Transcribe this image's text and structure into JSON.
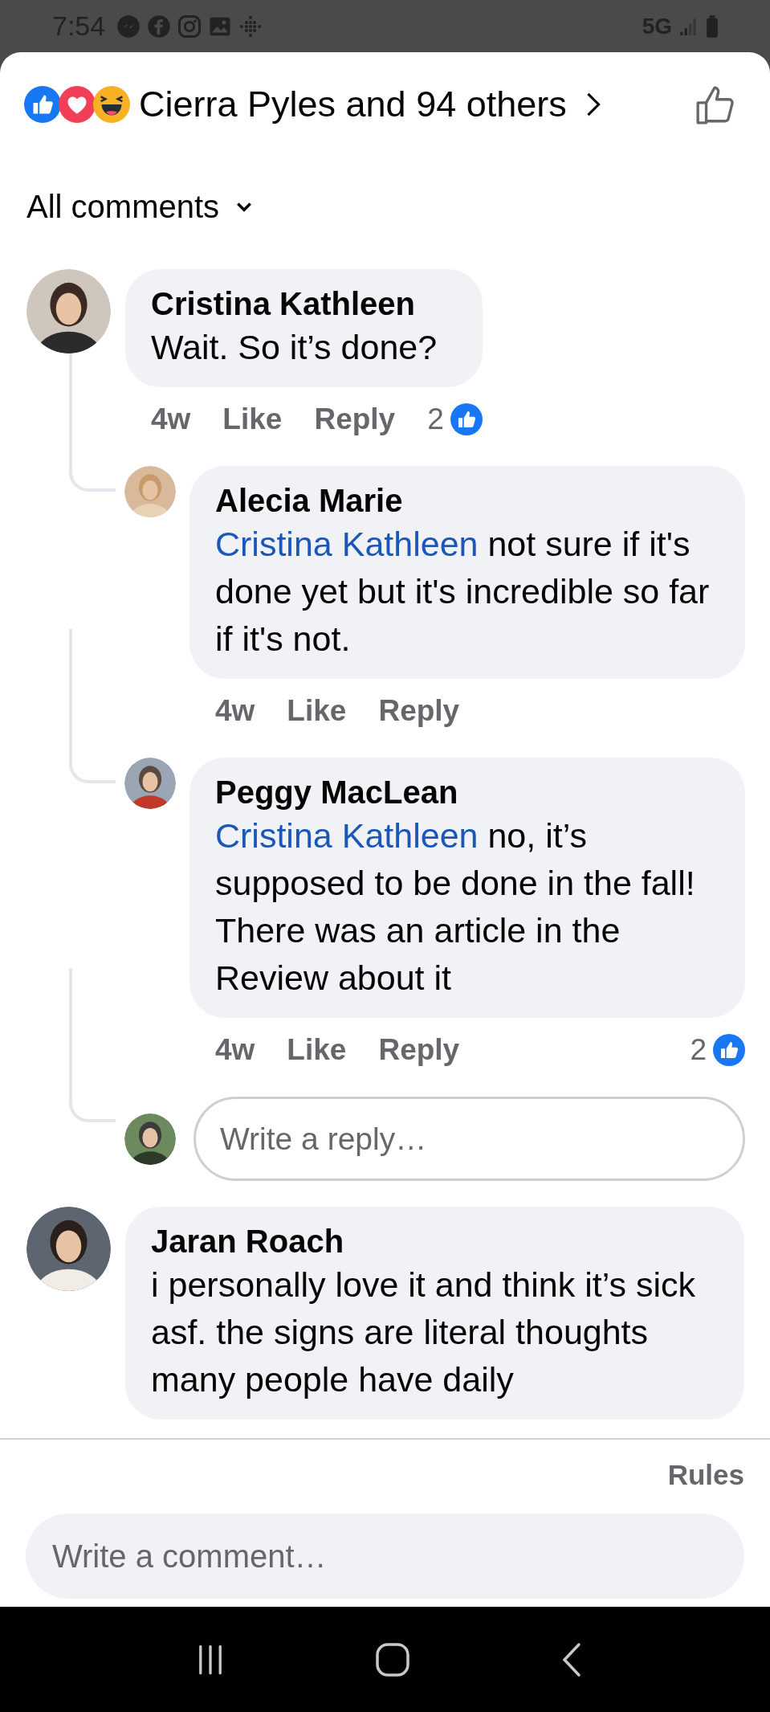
{
  "status_bar": {
    "time": "7:54",
    "network": "5G"
  },
  "reactions": {
    "summary": "Cierra Pyles and 94 others"
  },
  "filter": {
    "label": "All comments"
  },
  "comments": [
    {
      "author": "Cristina Kathleen",
      "text": "Wait. So it’s done?",
      "time": "4w",
      "like": "Like",
      "reply": "Reply",
      "reaction_count": "2",
      "replies": [
        {
          "author": "Alecia Marie",
          "mention": "Cristina Kathleen",
          "text": " not sure if it's done yet but it's incredible so far if it's not.",
          "time": "4w",
          "like": "Like",
          "reply": "Reply"
        },
        {
          "author": "Peggy MacLean",
          "mention": "Cristina Kathleen",
          "text": " no, it’s supposed to be done in the fall! There was an article in the Review about it",
          "time": "4w",
          "like": "Like",
          "reply": "Reply",
          "reaction_count": "2"
        }
      ],
      "reply_field": {
        "placeholder": "Write a reply…"
      }
    },
    {
      "author": "Jaran Roach",
      "text": "i personally love it and think it’s sick asf. the signs are literal thoughts many people have daily"
    }
  ],
  "footer": {
    "rules": "Rules",
    "comment_field": {
      "placeholder": "Write a comment…"
    }
  }
}
